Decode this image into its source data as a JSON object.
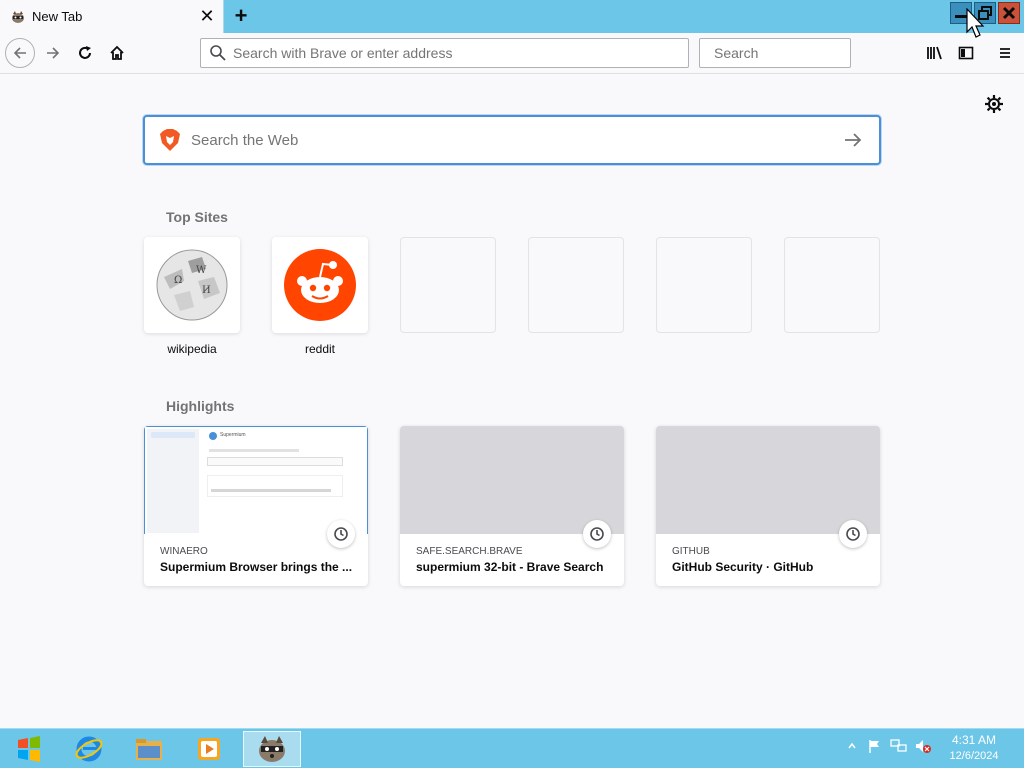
{
  "tab": {
    "title": "New Tab",
    "close": "✕"
  },
  "newtab": "+",
  "urlbar": {
    "placeholder": "Search with Brave or enter address"
  },
  "searchbar": {
    "placeholder": "Search"
  },
  "websearch": {
    "placeholder": "Search the Web"
  },
  "top_sites": {
    "heading": "Top Sites",
    "sites": [
      {
        "label": "wikipedia",
        "icon": "wikipedia-globe-icon"
      },
      {
        "label": "reddit",
        "icon": "reddit-alien-icon"
      }
    ]
  },
  "highlights": {
    "heading": "Highlights",
    "cards": [
      {
        "source": "WINAERO",
        "title": "Supermium Browser brings the ..."
      },
      {
        "source": "SAFE.SEARCH.BRAVE",
        "title": "supermium 32-bit - Brave Search"
      },
      {
        "source": "GITHUB",
        "title": "GitHub Security · GitHub"
      }
    ],
    "preview_text": "Supermium"
  },
  "taskbar": {
    "time": "4:31 AM",
    "date": "12/6/2024"
  },
  "colors": {
    "accent": "#4a90d9",
    "titlebar": "#6cc6e8",
    "reddit": "#ff4500"
  }
}
